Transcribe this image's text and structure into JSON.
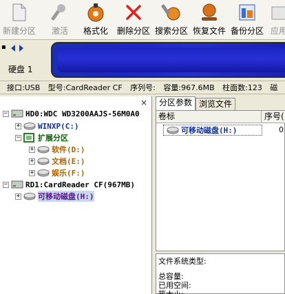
{
  "toolbar": {
    "new_partition": "新建分区",
    "activate": "激活",
    "format": "格式化",
    "delete_partition": "删除分区",
    "search_partition": "搜索分区",
    "recover_files": "恢复文件",
    "backup_partition": "备份分区",
    "apply": "应用"
  },
  "disk": {
    "label": "硬盘 1"
  },
  "info": {
    "interface": "接口:USB",
    "model": "型号:CardReader CF",
    "serial": "序列号:",
    "capacity": "容量:967.6MB",
    "cylinders": "柱面数:123",
    "trailing": "磁"
  },
  "tree": {
    "hd0": "HD0:WDC WD3200AAJS-56M0A0",
    "winxp": "WINXP(C:)",
    "extended": "扩展分区",
    "software": "软件(D:)",
    "docs": "文档(E:)",
    "entertainment": "娱乐(F:)",
    "rd1": "RD1:CardReader CF(967MB)",
    "removable": "可移动磁盘(H:)"
  },
  "tabs": {
    "params": "分区参数",
    "browse": "浏览文件"
  },
  "grid": {
    "col_volume": "卷标",
    "col_number": "序号(",
    "row_volume": "可移动磁盘(H:)",
    "row_number": "0"
  },
  "details": {
    "fs_type": "文件系统类型:",
    "total": "总容量:",
    "used": "已用空间:",
    "cluster": "簇大小:"
  }
}
